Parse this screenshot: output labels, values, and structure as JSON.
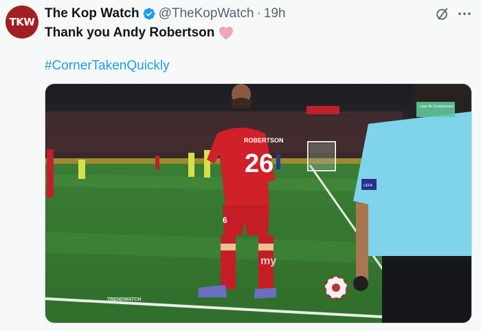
{
  "author": {
    "avatar_text": "TKW",
    "display_name": "The Kop Watch",
    "handle": "@TheKopWatch",
    "separator": "·",
    "timestamp": "19h",
    "verified_icon": "verified-badge-icon"
  },
  "tweet": {
    "text": "Thank you Andy Robertson",
    "emoji_icon": "pink-heart-icon",
    "hashtag": "#CornerTakenQuickly"
  },
  "actions": {
    "grok_icon": "grok-icon",
    "more_icon": "more-icon"
  },
  "media": {
    "jersey_name": "ROBERTSON",
    "jersey_number": "26",
    "shorts_number": "6",
    "watermark": "TRENDWATCH",
    "armband_text": "Liga de Campeones",
    "brand_mark": "my",
    "sleeve_badge": "UEFA"
  },
  "colors": {
    "accent": "#1d9bf0",
    "avatar_bg": "#a31e22",
    "liverpool_red": "#d0202a",
    "pitch_green": "#3f8a3a",
    "referee_shirt": "#7fd3ea"
  }
}
